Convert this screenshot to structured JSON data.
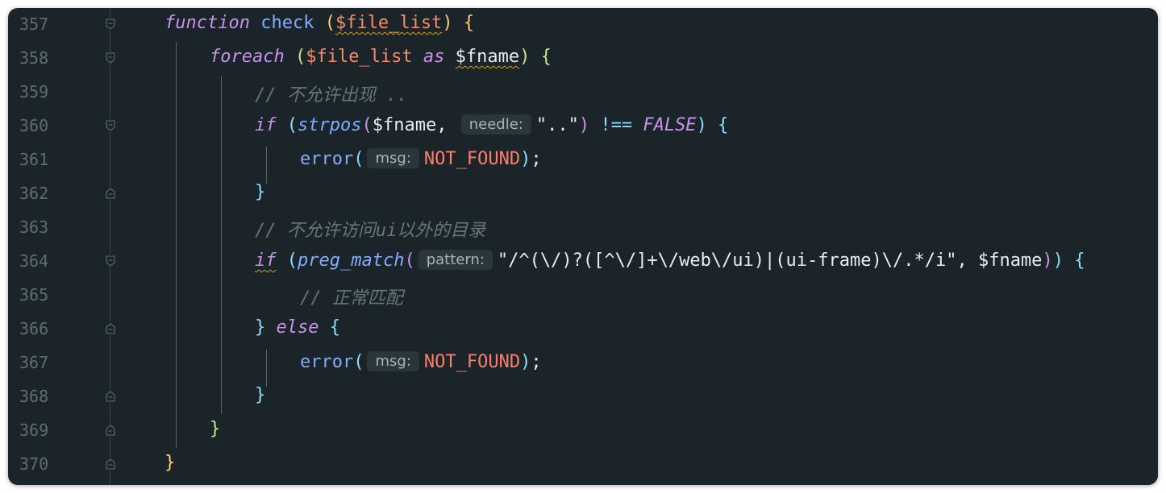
{
  "editor": {
    "lines": [
      {
        "num": "357"
      },
      {
        "num": "358"
      },
      {
        "num": "359"
      },
      {
        "num": "360"
      },
      {
        "num": "361"
      },
      {
        "num": "362"
      },
      {
        "num": "363"
      },
      {
        "num": "364"
      },
      {
        "num": "365"
      },
      {
        "num": "366"
      },
      {
        "num": "367"
      },
      {
        "num": "368"
      },
      {
        "num": "369"
      },
      {
        "num": "370"
      }
    ],
    "tokens": {
      "function": "function",
      "check": "check",
      "open_paren": "(",
      "file_list": "$file_list",
      "close_paren": ")",
      "open_brace": "{",
      "close_brace": "}",
      "foreach": "foreach",
      "as": "as",
      "fname": "$fname",
      "comment_359": "// 不允许出现 ..",
      "if": "if",
      "strpos": "strpos",
      "comma": ",",
      "needle_hint": "needle:",
      "dotdot_str": "\"..\"",
      "not_identical": "!==",
      "false": "FALSE",
      "error": "error",
      "msg_hint": "msg:",
      "not_found": "NOT_FOUND",
      "semicolon": ";",
      "comment_363": "// 不允许访问ui以外的目录",
      "preg_match": "preg_match",
      "pattern_hint": "pattern:",
      "regex": "\"/^(\\/)?([^\\/]+\\/web\\/ui)|(ui-frame)\\/.*/i\"",
      "comment_365": "// 正常匹配",
      "else": "else"
    }
  }
}
